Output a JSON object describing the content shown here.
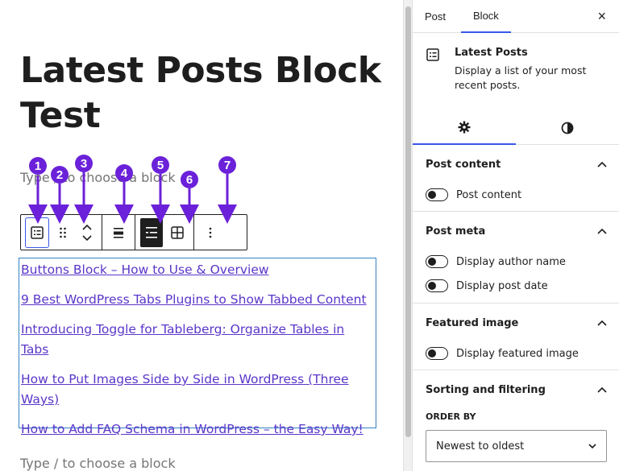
{
  "editor": {
    "post_title": "Latest Posts Block Test",
    "placeholder_top": "Type / to choose a block",
    "placeholder_bottom": "Type / to choose a block",
    "posts": [
      "Buttons Block – How to Use & Overview",
      "9 Best WordPress Tabs Plugins to Show Tabbed Content",
      "Introducing Toggle for Tableberg: Organize Tables in Tabs",
      "How to Put Images Side by Side in WordPress (Three Ways)",
      "How to Add FAQ Schema in WordPress – the Easy Way!"
    ],
    "toolbar": {
      "icons": [
        "latest-posts-icon",
        "drag-handle-icon",
        "move-up-icon",
        "move-down-icon",
        "align-icon",
        "list-view-icon",
        "grid-view-icon",
        "more-options-icon"
      ]
    },
    "callouts": [
      "1",
      "2",
      "3",
      "4",
      "5",
      "6",
      "7"
    ],
    "accent_color": "#6b21d9",
    "link_color": "#5a36c9"
  },
  "sidebar": {
    "tabs": [
      "Post",
      "Block"
    ],
    "active_tab": "Block",
    "close_glyph": "×",
    "block_card": {
      "title": "Latest Posts",
      "description": "Display a list of your most recent posts."
    },
    "sub_tabs": [
      "gear-icon",
      "contrast-icon"
    ],
    "panels": {
      "post_content": {
        "title": "Post content",
        "toggles": [
          "Post content"
        ]
      },
      "post_meta": {
        "title": "Post meta",
        "toggles": [
          "Display author name",
          "Display post date"
        ]
      },
      "featured_image": {
        "title": "Featured image",
        "toggles": [
          "Display featured image"
        ]
      },
      "sorting": {
        "title": "Sorting and filtering",
        "order_by_label": "ORDER BY",
        "order_by_value": "Newest to oldest"
      }
    },
    "tab_accent": "#3858e9"
  }
}
